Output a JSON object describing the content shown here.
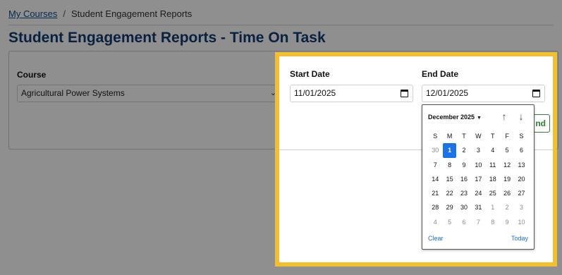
{
  "breadcrumb": {
    "link": "My Courses",
    "separator": "/",
    "current": "Student Engagement Reports"
  },
  "page_title": "Student Engagement Reports - Time On Task",
  "filters": {
    "course_label": "Course",
    "course_value": "Agricultural Power Systems",
    "start_label": "Start Date",
    "start_value": "11/01/2025",
    "end_label": "End Date",
    "end_value": "12/01/2025",
    "submit_button_visible_text": "nd"
  },
  "calendar": {
    "month_label": "December 2025",
    "weekdays": [
      "S",
      "M",
      "T",
      "W",
      "T",
      "F",
      "S"
    ],
    "weeks": [
      [
        "30",
        "1",
        "2",
        "3",
        "4",
        "5",
        "6"
      ],
      [
        "7",
        "8",
        "9",
        "10",
        "11",
        "12",
        "13"
      ],
      [
        "14",
        "15",
        "16",
        "17",
        "18",
        "19",
        "20"
      ],
      [
        "21",
        "22",
        "23",
        "24",
        "25",
        "26",
        "27"
      ],
      [
        "28",
        "29",
        "30",
        "31",
        "1",
        "2",
        "3"
      ],
      [
        "4",
        "5",
        "6",
        "7",
        "8",
        "9",
        "10"
      ]
    ],
    "selected": "1",
    "clear_label": "Clear",
    "today_label": "Today"
  },
  "colors": {
    "highlight": "#f2bf2f",
    "title": "#0f3d73",
    "selected_day": "#1a73e8"
  }
}
